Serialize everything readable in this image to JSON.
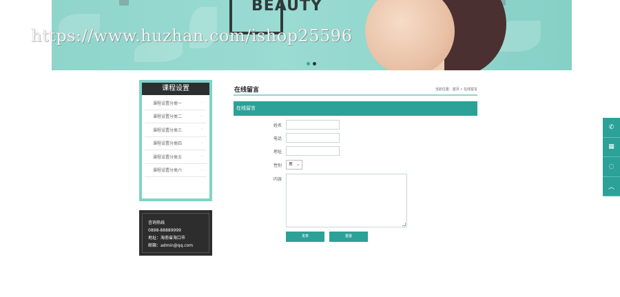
{
  "banner": {
    "brand_text": "BEAUTY",
    "slides": 2,
    "active_slide": 2
  },
  "watermark": "https://www.huzhan.com/ishop25596",
  "sidebar": {
    "title": "课程设置",
    "items": [
      {
        "label": "课程设置分类一",
        "arrow": "›"
      },
      {
        "label": "课程设置分类二",
        "arrow": "›"
      },
      {
        "label": "课程设置分类三",
        "arrow": "›"
      },
      {
        "label": "课程设置分类四",
        "arrow": "›"
      },
      {
        "label": "课程设置分类五",
        "arrow": "›"
      },
      {
        "label": "课程设置分类六",
        "arrow": "›"
      }
    ]
  },
  "contact": {
    "hotline_label": "咨询热线",
    "phone": "0898-88889999",
    "address": "地址：海南省海口市",
    "email": "邮箱：admin@qq.com"
  },
  "main": {
    "title": "在线留言",
    "breadcrumb": "当前位置：首页 » 在线留言",
    "section_bar": "在线留言"
  },
  "form": {
    "name_label": "姓名",
    "phone_label": "电话",
    "address_label": "地址",
    "gender_label": "性别",
    "gender_value": "男",
    "content_label": "内容",
    "submit_label": "发表",
    "reset_label": "重置"
  },
  "floatbar": {
    "icons": [
      "phone-icon",
      "qrcode-icon",
      "qq-icon",
      "back-to-top-icon"
    ],
    "glyphs": [
      "✆",
      "▦",
      "◌",
      "︿"
    ]
  },
  "colors": {
    "accent": "#2ba197",
    "banner": "#8fd5cc",
    "dark": "#2d2d2d"
  }
}
